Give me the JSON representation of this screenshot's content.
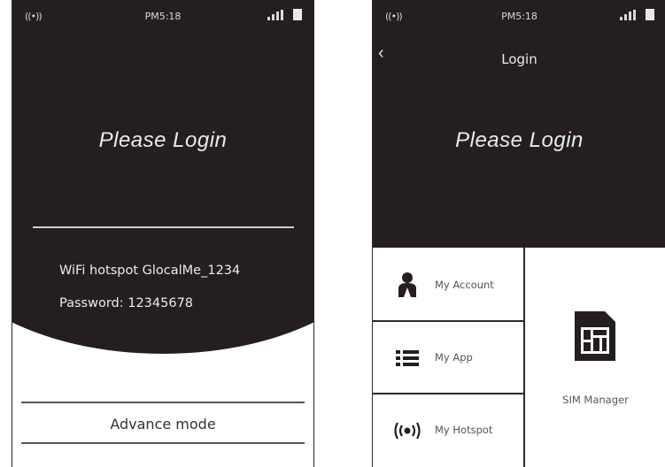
{
  "left_screen": {
    "status": {
      "signal_icon": "vibrate-icon",
      "time": "PM5:18"
    },
    "title": "Please Login",
    "wifi_hotspot": "WiFi hotspot  GlocalMe_1234",
    "password": "Password: 12345678",
    "advance_mode": "Advance mode"
  },
  "right_screen": {
    "status": {
      "signal_icon": "vibrate-icon",
      "time": "PM5:18"
    },
    "nav_title": "Login",
    "title": "Please Login",
    "menu": {
      "my_account": "My Account",
      "my_app": "My App",
      "my_hotspot": "My Hotspot",
      "sim_manager": "SIM Manager"
    }
  },
  "colors": {
    "dark_background": "#231f20",
    "text_light": "#eaeaea"
  }
}
